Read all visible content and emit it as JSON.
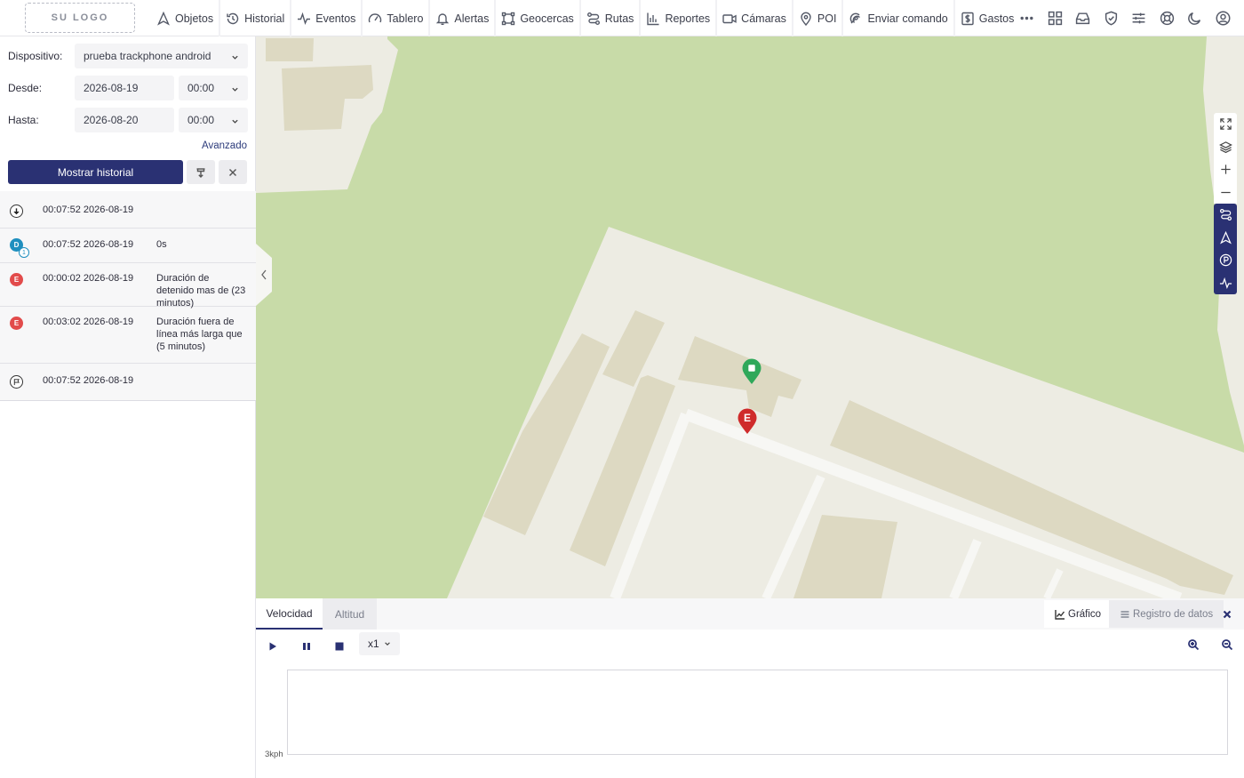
{
  "header": {
    "logo": "SU LOGO",
    "nav": [
      {
        "label": "Objetos",
        "icon": "navigation-icon"
      },
      {
        "label": "Historial",
        "icon": "history-icon"
      },
      {
        "label": "Eventos",
        "icon": "pulse-icon"
      },
      {
        "label": "Tablero",
        "icon": "gauge-icon"
      },
      {
        "label": "Alertas",
        "icon": "bell-icon"
      },
      {
        "label": "Geocercas",
        "icon": "geofence-icon"
      },
      {
        "label": "Rutas",
        "icon": "route-icon"
      },
      {
        "label": "Reportes",
        "icon": "bar-chart-icon"
      },
      {
        "label": "Cámaras",
        "icon": "video-icon"
      },
      {
        "label": "POI",
        "icon": "map-pin-icon"
      },
      {
        "label": "Enviar comando",
        "icon": "satellite-icon"
      },
      {
        "label": "Gastos",
        "icon": "dollar-icon"
      }
    ],
    "right_icons": [
      "more-icon",
      "grid-icon",
      "inbox-icon",
      "shield-icon",
      "sliders-icon",
      "lifebuoy-icon",
      "moon-icon",
      "user-icon"
    ]
  },
  "sidebar": {
    "device_label": "Dispositivo:",
    "device_value": "prueba trackphone android",
    "from_label": "Desde:",
    "from_date": "2026-08-19",
    "from_time": "00:00",
    "to_label": "Hasta:",
    "to_date": "2026-08-20",
    "to_time": "00:00",
    "advanced": "Avanzado",
    "show_button": "Mostrar historial",
    "history": [
      {
        "icon": "arrow-down-icon",
        "time": "00:07:52 2026-08-19",
        "desc": ""
      },
      {
        "icon": "D",
        "badge": "1",
        "time": "00:07:52 2026-08-19",
        "desc": "0s"
      },
      {
        "icon": "E",
        "time": "00:00:02 2026-08-19",
        "desc": "Duración de detenido mas de (23 minutos)"
      },
      {
        "icon": "E",
        "time": "00:03:02 2026-08-19",
        "desc": "Duración fuera de línea más larga que (5 minutos)"
      },
      {
        "icon": "flag-icon",
        "time": "00:07:52 2026-08-19",
        "desc": ""
      }
    ]
  },
  "map": {
    "markers": [
      {
        "name": "start-marker",
        "label": "",
        "color": "#2fa85a"
      },
      {
        "name": "event-marker",
        "label": "E",
        "color": "#cf2b2b"
      }
    ],
    "controls": [
      "fullscreen-icon",
      "layers-icon",
      "zoom-in-icon",
      "zoom-out-icon",
      "route-icon",
      "navigation-icon",
      "parking-icon",
      "pulse-icon"
    ]
  },
  "bottom": {
    "tabs": [
      "Velocidad",
      "Altitud"
    ],
    "view_chart": "Gráfico",
    "view_log": "Registro de datos",
    "speed": "x1",
    "y_label": "3kph"
  },
  "colors": {
    "primary": "#2a3173",
    "event_red": "#e24b4b",
    "status_teal": "#1f8fbf",
    "map_green": "#c8dba8",
    "map_land": "#edece3"
  }
}
